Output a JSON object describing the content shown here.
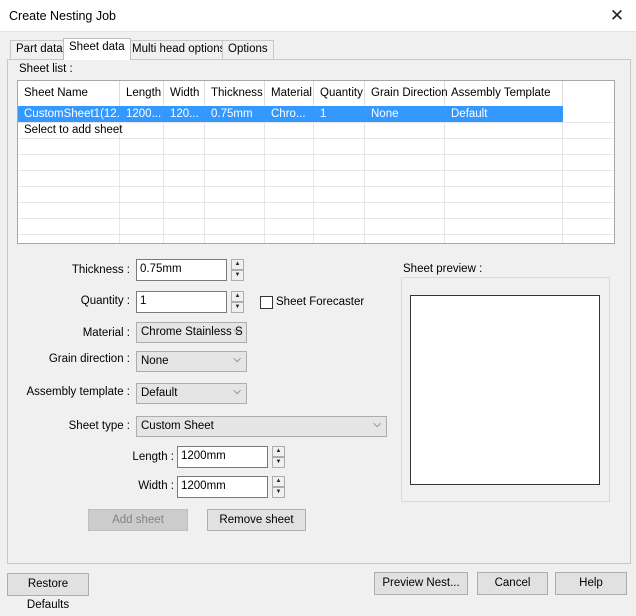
{
  "window": {
    "title": "Create Nesting Job",
    "close_glyph": "✕"
  },
  "tabs": [
    "Part data",
    "Sheet data",
    "Multi head options",
    "Options"
  ],
  "active_tab": "Sheet data",
  "sheet_list": {
    "label": "Sheet list :",
    "columns": [
      "Sheet Name",
      "Length",
      "Width",
      "Thickness",
      "Material",
      "Quantity",
      "Grain Direction",
      "Assembly Template"
    ],
    "rows": [
      [
        "CustomSheet1(12...",
        "1200...",
        "120...",
        "0.75mm",
        "Chro...",
        "1",
        "None",
        "Default"
      ]
    ],
    "add_row_text": "Select to add sheet"
  },
  "form": {
    "thickness_label": "Thickness :",
    "thickness_value": "0.75mm",
    "quantity_label": "Quantity :",
    "quantity_value": "1",
    "sheet_forecaster_label": "Sheet Forecaster",
    "sheet_forecaster_checked": false,
    "material_label": "Material :",
    "material_value": "Chrome Stainless S",
    "grain_label": "Grain direction :",
    "grain_value": "None",
    "assembly_label": "Assembly template :",
    "assembly_value": "Default",
    "sheet_type_label": "Sheet type :",
    "sheet_type_value": "Custom Sheet",
    "length_label": "Length :",
    "length_value": "1200mm",
    "width_label": "Width :",
    "width_value": "1200mm",
    "add_sheet": "Add sheet",
    "remove_sheet": "Remove sheet"
  },
  "preview": {
    "label": "Sheet preview :"
  },
  "footer": {
    "restore_defaults": "Restore Defaults",
    "preview_nest": "Preview Nest...",
    "cancel": "Cancel",
    "help": "Help"
  },
  "colors": {
    "selection": "#3399ff",
    "dialog_bg": "#f0f0f0"
  }
}
